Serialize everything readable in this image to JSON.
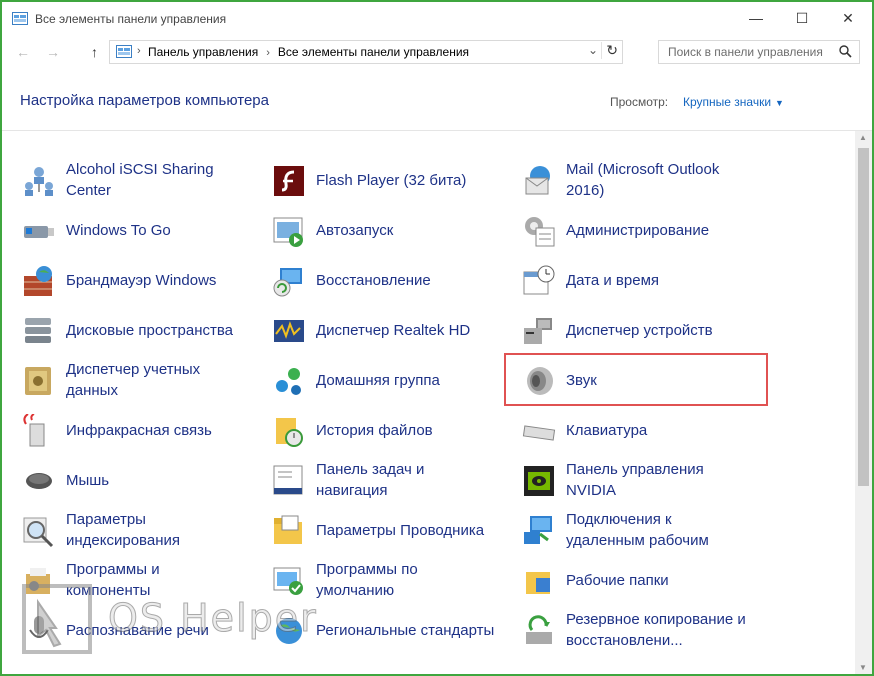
{
  "window": {
    "title": "Все элементы панели управления",
    "controls": {
      "minimize": "—",
      "maximize": "☐",
      "close": "✕"
    }
  },
  "address_bar": {
    "back": "←",
    "forward": "→",
    "up": "↑",
    "crumbs": [
      "Панель управления",
      "Все элементы панели управления"
    ],
    "separator": "›",
    "dropdown": "⌄",
    "refresh": "↻"
  },
  "search": {
    "placeholder": "Поиск в панели управления",
    "icon": "search-icon"
  },
  "header": {
    "title": "Настройка параметров компьютера",
    "view_label": "Просмотр:",
    "view_value": "Крупные значки"
  },
  "items": [
    {
      "id": "alcohol",
      "col": 0,
      "row": 0,
      "lines": [
        "Alcohol iSCSI Sharing",
        "Center"
      ],
      "icon": "network-users-icon"
    },
    {
      "id": "windows-to-go",
      "col": 0,
      "row": 1,
      "lines": [
        "Windows To Go"
      ],
      "icon": "usb-drive-icon"
    },
    {
      "id": "firewall",
      "col": 0,
      "row": 2,
      "lines": [
        "Брандмауэр Windows"
      ],
      "icon": "firewall-icon"
    },
    {
      "id": "storage-spaces",
      "col": 0,
      "row": 3,
      "lines": [
        "Дисковые пространства"
      ],
      "icon": "disk-stack-icon"
    },
    {
      "id": "credential-manager",
      "col": 0,
      "row": 4,
      "lines": [
        "Диспетчер учетных",
        "данных"
      ],
      "icon": "vault-icon"
    },
    {
      "id": "infrared",
      "col": 0,
      "row": 5,
      "lines": [
        "Инфракрасная связь"
      ],
      "icon": "infrared-icon"
    },
    {
      "id": "mouse",
      "col": 0,
      "row": 6,
      "lines": [
        "Мышь"
      ],
      "icon": "mouse-icon"
    },
    {
      "id": "indexing",
      "col": 0,
      "row": 7,
      "lines": [
        "Параметры",
        "индексирования"
      ],
      "icon": "magnifier-icon"
    },
    {
      "id": "programs",
      "col": 0,
      "row": 8,
      "lines": [
        "Программы и",
        "компоненты"
      ],
      "icon": "programs-box-icon"
    },
    {
      "id": "speech",
      "col": 0,
      "row": 9,
      "lines": [
        "Распознавание речи"
      ],
      "icon": "microphone-icon"
    },
    {
      "id": "flash",
      "col": 1,
      "row": 0,
      "lines": [
        "Flash Player (32 бита)"
      ],
      "icon": "flash-icon"
    },
    {
      "id": "autoplay",
      "col": 1,
      "row": 1,
      "lines": [
        "Автозапуск"
      ],
      "icon": "autoplay-icon"
    },
    {
      "id": "recovery",
      "col": 1,
      "row": 2,
      "lines": [
        "Восстановление"
      ],
      "icon": "recovery-icon"
    },
    {
      "id": "realtek",
      "col": 1,
      "row": 3,
      "lines": [
        "Диспетчер Realtek HD"
      ],
      "icon": "realtek-icon"
    },
    {
      "id": "homegroup",
      "col": 1,
      "row": 4,
      "lines": [
        "Домашняя группа"
      ],
      "icon": "homegroup-icon"
    },
    {
      "id": "file-history",
      "col": 1,
      "row": 5,
      "lines": [
        "История файлов"
      ],
      "icon": "file-history-icon"
    },
    {
      "id": "taskbar",
      "col": 1,
      "row": 6,
      "lines": [
        "Панель задач и",
        "навигация"
      ],
      "icon": "taskbar-icon"
    },
    {
      "id": "explorer-options",
      "col": 1,
      "row": 7,
      "lines": [
        "Параметры Проводника"
      ],
      "icon": "folder-options-icon"
    },
    {
      "id": "default-programs",
      "col": 1,
      "row": 8,
      "lines": [
        "Программы по",
        "умолчанию"
      ],
      "icon": "default-programs-icon"
    },
    {
      "id": "region",
      "col": 1,
      "row": 9,
      "lines": [
        "Региональные стандарты"
      ],
      "icon": "region-icon"
    },
    {
      "id": "mail",
      "col": 2,
      "row": 0,
      "lines": [
        "Mail (Microsoft Outlook",
        "2016)"
      ],
      "icon": "mail-icon"
    },
    {
      "id": "admin",
      "col": 2,
      "row": 1,
      "lines": [
        "Администрирование"
      ],
      "icon": "admin-tools-icon"
    },
    {
      "id": "datetime",
      "col": 2,
      "row": 2,
      "lines": [
        "Дата и время"
      ],
      "icon": "calendar-clock-icon"
    },
    {
      "id": "device-manager",
      "col": 2,
      "row": 3,
      "lines": [
        "Диспетчер устройств"
      ],
      "icon": "device-manager-icon"
    },
    {
      "id": "sound",
      "col": 2,
      "row": 4,
      "lines": [
        "Звук"
      ],
      "icon": "speaker-icon"
    },
    {
      "id": "keyboard",
      "col": 2,
      "row": 5,
      "lines": [
        "Клавиатура"
      ],
      "icon": "keyboard-icon"
    },
    {
      "id": "nvidia",
      "col": 2,
      "row": 6,
      "lines": [
        "Панель управления",
        "NVIDIA"
      ],
      "icon": "nvidia-icon"
    },
    {
      "id": "remote",
      "col": 2,
      "row": 7,
      "lines": [
        "Подключения к",
        "удаленным рабочим"
      ],
      "icon": "remote-desktop-icon"
    },
    {
      "id": "work-folders",
      "col": 2,
      "row": 8,
      "lines": [
        "Рабочие папки"
      ],
      "icon": "work-folders-icon"
    },
    {
      "id": "backup",
      "col": 2,
      "row": 9,
      "lines": [
        "Резервное копирование и",
        "восстановлени..."
      ],
      "icon": "backup-icon"
    }
  ],
  "watermark": {
    "text": "OS Helper"
  },
  "colors": {
    "link": "#1e3287",
    "accent": "#1466c0",
    "highlight": "#e05252",
    "frame": "#3fa63f"
  }
}
